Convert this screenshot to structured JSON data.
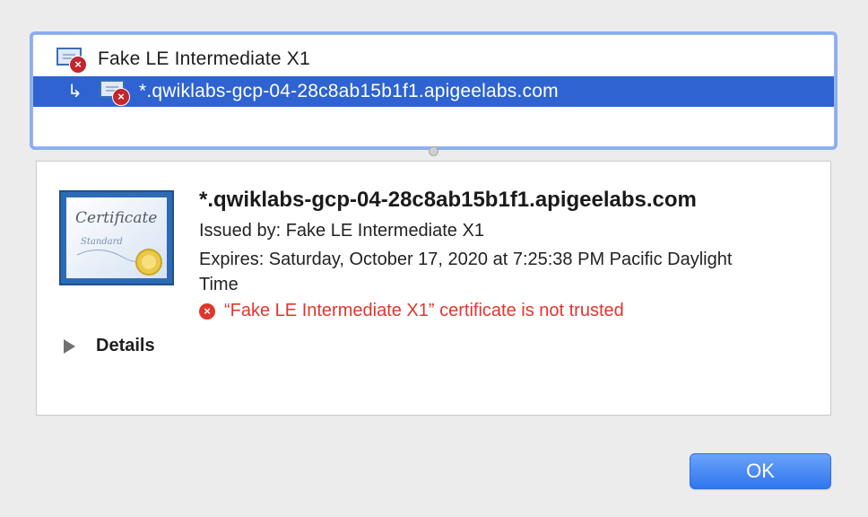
{
  "chain": {
    "items": [
      {
        "label": "Fake LE Intermediate X1",
        "icon": "certificate-error-icon"
      },
      {
        "label": "*.qwiklabs-gcp-04-28c8ab15b1f1.apigeelabs.com",
        "icon": "certificate-error-icon",
        "selected": true
      }
    ],
    "arrow": "↳"
  },
  "detail": {
    "title": "*.qwiklabs-gcp-04-28c8ab15b1f1.apigeelabs.com",
    "issued_by": "Issued by: Fake LE Intermediate X1",
    "expires": "Expires: Saturday, October 17, 2020 at 7:25:38 PM Pacific Daylight Time",
    "trust_status": "“Fake LE Intermediate X1” certificate is not trusted",
    "trust_icon": "×",
    "details_label": "Details",
    "certificate_image_text": [
      "Certificate",
      "Standard"
    ]
  },
  "buttons": {
    "ok_label": "OK"
  },
  "colors": {
    "selection": "#2e63d1",
    "error": "#e0362c",
    "accent": "#2f76ef"
  }
}
